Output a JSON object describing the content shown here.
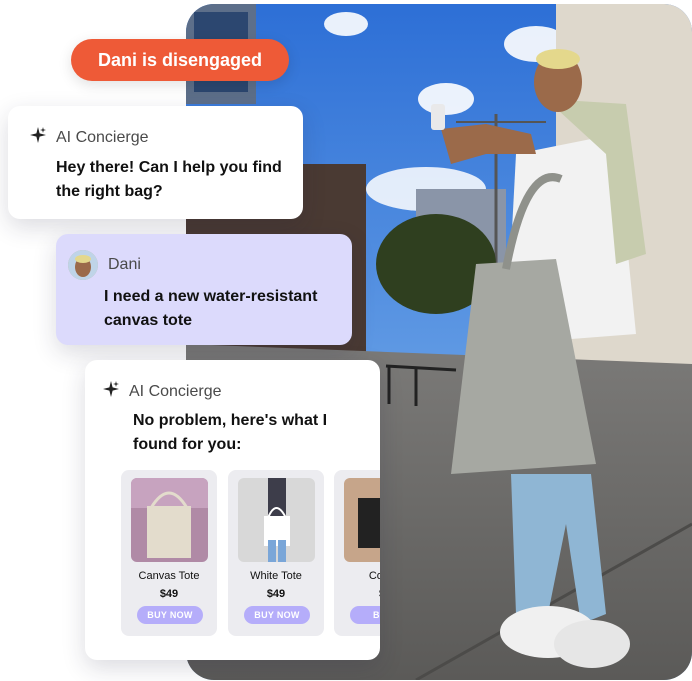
{
  "status_pill": {
    "text": "Dani is disengaged",
    "color": "#ee5a37"
  },
  "messages": [
    {
      "sender": "AI Concierge",
      "icon": "sparkle-icon",
      "text": "Hey there! Can I help you find the right bag?"
    },
    {
      "sender": "Dani",
      "icon": "avatar",
      "text": "I need a new water-resistant canvas tote"
    },
    {
      "sender": "AI Concierge",
      "icon": "sparkle-icon",
      "text": "No problem, here's what I found for you:"
    }
  ],
  "products": [
    {
      "name": "Canvas Tote",
      "price": "$49",
      "button": "BUY NOW"
    },
    {
      "name": "White Tote",
      "price": "$49",
      "button": "BUY NOW"
    },
    {
      "name": "Cotto",
      "price": "$",
      "button": "BUY"
    }
  ],
  "colors": {
    "accent_purple": "#b5adfa",
    "user_bubble": "#dcdafc",
    "pill": "#ee5a37"
  }
}
